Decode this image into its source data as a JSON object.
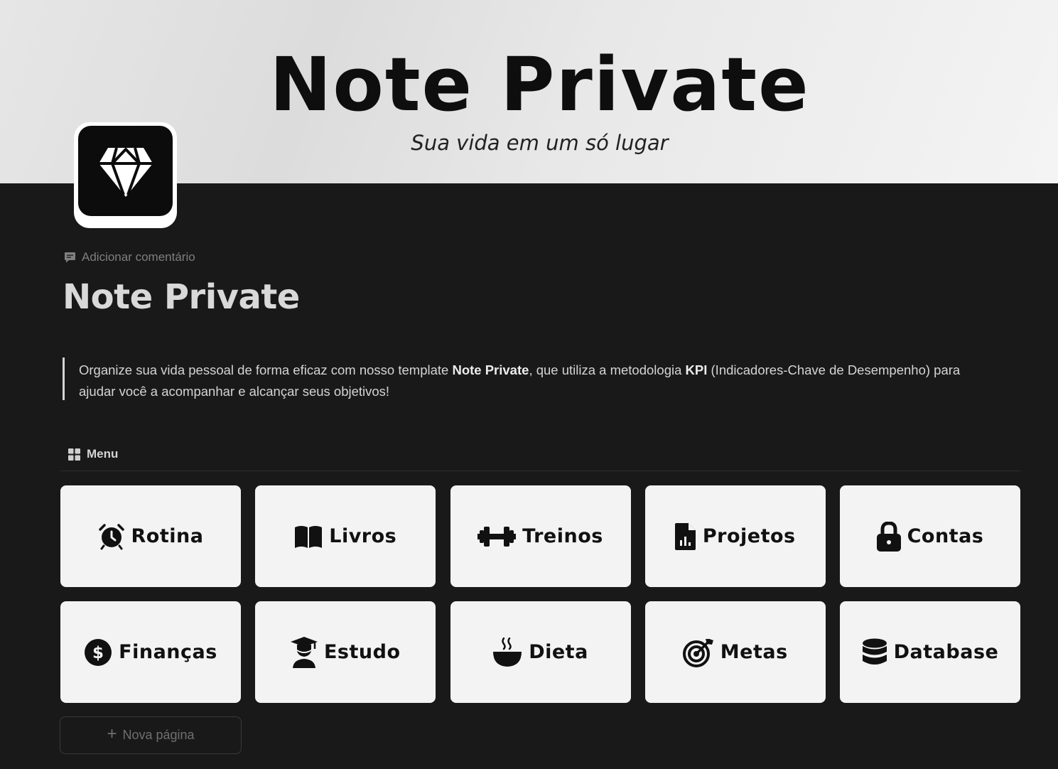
{
  "cover": {
    "title": "Note Private",
    "subtitle": "Sua vida em um só lugar"
  },
  "page": {
    "icon": "diamond-icon",
    "comment_label": "Adicionar comentário",
    "title": "Note Private"
  },
  "quote": {
    "part1": "Organize sua vida pessoal de forma eficaz com nosso template ",
    "bold1": "Note Private",
    "part2": ", que utiliza a metodologia ",
    "bold2": "KPI",
    "part3": " (Indicadores-Chave de Desempenho) para ajudar você a acompanhar e alcançar seus objetivos!"
  },
  "menu": {
    "label": "Menu",
    "cards": [
      {
        "label": "Rotina",
        "icon": "alarm-clock-icon"
      },
      {
        "label": "Livros",
        "icon": "book-icon"
      },
      {
        "label": "Treinos",
        "icon": "dumbbell-icon"
      },
      {
        "label": "Projetos",
        "icon": "file-chart-icon"
      },
      {
        "label": "Contas",
        "icon": "lock-icon"
      },
      {
        "label": "Finanças",
        "icon": "dollar-circle-icon"
      },
      {
        "label": "Estudo",
        "icon": "graduate-icon"
      },
      {
        "label": "Dieta",
        "icon": "bowl-icon"
      },
      {
        "label": "Metas",
        "icon": "target-icon"
      },
      {
        "label": "Database",
        "icon": "database-icon"
      }
    ],
    "new_page_label": "Nova página"
  },
  "colors": {
    "background": "#191919",
    "card": "#f3f3f3",
    "cover": "#e6e6e6"
  }
}
